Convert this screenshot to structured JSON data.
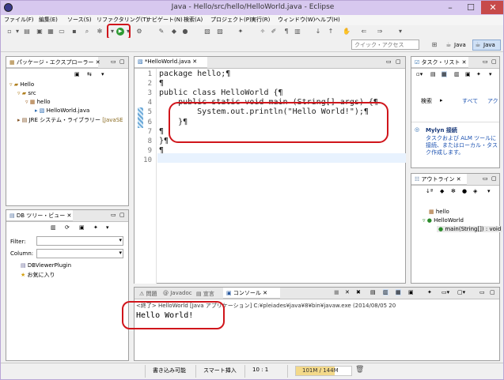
{
  "window": {
    "title": "Java - Hello/src/hello/HelloWorld.java - Eclipse"
  },
  "menu": [
    "ファイル(F)",
    "編集(E)",
    "ソース(S)",
    "リファクタリング(T)",
    "ナビゲート(N)",
    "検索(A)",
    "プロジェクト(P)",
    "実行(R)",
    "ウィンドウ(W)",
    "ヘルプ(H)"
  ],
  "quick_access": {
    "placeholder": "クイック・アクセス"
  },
  "perspectives": {
    "java": "Java",
    "java_ee": "Java"
  },
  "package_explorer": {
    "title": "パッケージ・エクスプローラー",
    "tree": [
      {
        "label": "Hello"
      },
      {
        "label": "src"
      },
      {
        "label": "hello"
      },
      {
        "label": "HelloWorld.java"
      },
      {
        "label": "JRE システム・ライブラリー",
        "suffix": "[JavaSE"
      }
    ]
  },
  "db_viewer": {
    "title": "DB ツリー・ビュー",
    "filter_label": "Filter:",
    "column_label": "Column:",
    "items": [
      "DBViewerPlugin",
      "お気に入り"
    ]
  },
  "editor": {
    "tab": "*HelloWorld.java",
    "lines": [
      {
        "no": "1",
        "text": "package hello;¶"
      },
      {
        "no": "2",
        "text": "¶"
      },
      {
        "no": "3",
        "text": "public class HelloWorld {¶"
      },
      {
        "no": "4",
        "text": "    public static void main (String[] args) {¶"
      },
      {
        "no": "5",
        "text": "        System.out.println(\"Hello World!\");¶"
      },
      {
        "no": "6",
        "text": "    }¶"
      },
      {
        "no": "7",
        "text": "¶"
      },
      {
        "no": "8",
        "text": "}¶"
      },
      {
        "no": "9",
        "text": "¶"
      },
      {
        "no": "10",
        "text": ""
      }
    ]
  },
  "task_list": {
    "title": "タスク・リスト",
    "find_label": "検索",
    "all_label": "すべて",
    "act_label": "アク"
  },
  "mylyn": {
    "title": "Mylyn 接続",
    "description": "タスクおよび ALM ツールに接続、またはローカル・タスク作成します。"
  },
  "outline": {
    "title": "アウトライン",
    "items": [
      "hello",
      "HelloWorld",
      "main(String[]) : void"
    ]
  },
  "bottom_panel": {
    "tabs": [
      "問題",
      "Javadoc",
      "宣言",
      "コンソール"
    ],
    "console_header": "<終了> HelloWorld [Java アプリケーション] C:¥pleiades¥java¥8¥bin¥javaw.exe (2014/08/05 20",
    "console_output": "Hello World!"
  },
  "status": {
    "writable": "書き込み可能",
    "insert_mode": "スマート挿入",
    "position": "10 : 1",
    "memory": "101M / 144M",
    "memory_fraction": 0.7
  }
}
